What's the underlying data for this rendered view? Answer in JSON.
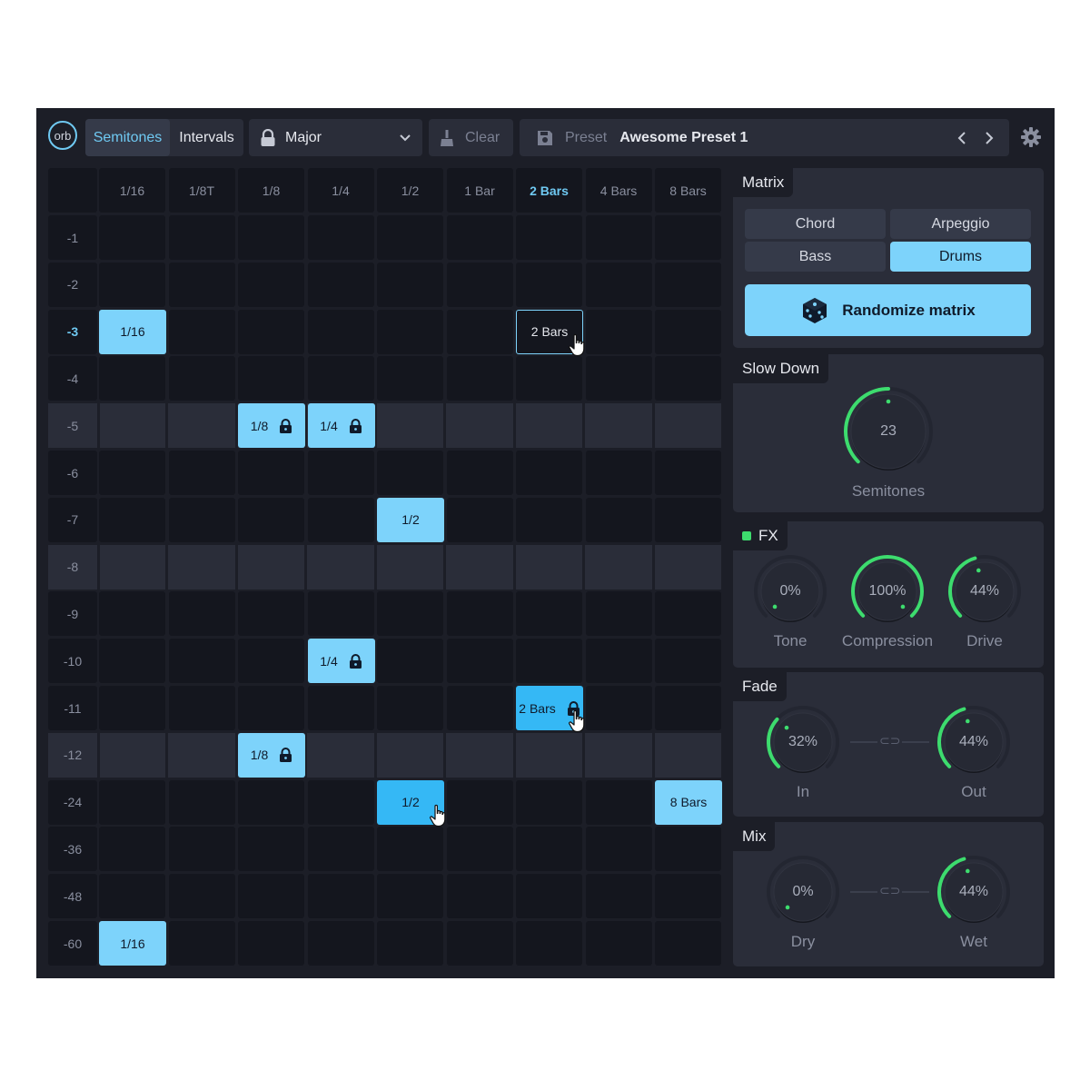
{
  "toolbar": {
    "logo": "orb",
    "tabs": [
      {
        "label": "Semitones",
        "active": true
      },
      {
        "label": "Intervals",
        "active": false
      }
    ],
    "scale": {
      "label": "Major"
    },
    "clear": {
      "label": "Clear"
    },
    "preset": {
      "label": "Preset",
      "name": "Awesome Preset 1"
    }
  },
  "matrix": {
    "columns": [
      "1/16",
      "1/8T",
      "1/8",
      "1/4",
      "1/2",
      "1 Bar",
      "2 Bars",
      "4 Bars",
      "8 Bars"
    ],
    "highlight_column": "2 Bars",
    "rows": [
      "-1",
      "-2",
      "-3",
      "-4",
      "-5",
      "-6",
      "-7",
      "-8",
      "-9",
      "-10",
      "-11",
      "-12",
      "-24",
      "-36",
      "-48",
      "-60"
    ],
    "highlight_row": "-3",
    "locked_rows": [
      "-5",
      "-8",
      "-12"
    ],
    "cells": [
      {
        "row": "-3",
        "col": "1/16",
        "label": "1/16",
        "style": "filled",
        "locked": false
      },
      {
        "row": "-3",
        "col": "2 Bars",
        "label": "2 Bars",
        "style": "outline",
        "locked": false,
        "cursor": true
      },
      {
        "row": "-5",
        "col": "1/8",
        "label": "1/8",
        "style": "filled",
        "locked": true
      },
      {
        "row": "-5",
        "col": "1/4",
        "label": "1/4",
        "style": "filled",
        "locked": true
      },
      {
        "row": "-7",
        "col": "1/2",
        "label": "1/2",
        "style": "filled",
        "locked": false
      },
      {
        "row": "-10",
        "col": "1/4",
        "label": "1/4",
        "style": "filled",
        "locked": true
      },
      {
        "row": "-11",
        "col": "2 Bars",
        "label": "2 Bars",
        "style": "bright",
        "locked": true,
        "cursor": true
      },
      {
        "row": "-12",
        "col": "1/8",
        "label": "1/8",
        "style": "filled",
        "locked": true
      },
      {
        "row": "-24",
        "col": "1/2",
        "label": "1/2",
        "style": "bright",
        "locked": false,
        "cursor": true
      },
      {
        "row": "-24",
        "col": "8 Bars",
        "label": "8 Bars",
        "style": "filled",
        "locked": false
      },
      {
        "row": "-60",
        "col": "1/16",
        "label": "1/16",
        "style": "filled",
        "locked": false
      }
    ]
  },
  "panels": {
    "matrix": {
      "title": "Matrix",
      "modes": [
        {
          "label": "Chord",
          "active": false
        },
        {
          "label": "Arpeggio",
          "active": false
        },
        {
          "label": "Bass",
          "active": false
        },
        {
          "label": "Drums",
          "active": true
        }
      ],
      "randomize_label": "Randomize matrix"
    },
    "slowdown": {
      "title": "Slow Down",
      "knob": {
        "value": "23",
        "label": "Semitones",
        "level": 0.5
      }
    },
    "fx": {
      "title": "FX",
      "enabled": true,
      "knobs": [
        {
          "value": "0%",
          "label": "Tone",
          "level": 0
        },
        {
          "value": "100%",
          "label": "Compression",
          "level": 1
        },
        {
          "value": "44%",
          "label": "Drive",
          "level": 0.44
        }
      ]
    },
    "fade": {
      "title": "Fade",
      "knobs": [
        {
          "value": "32%",
          "label": "In",
          "level": 0.32
        },
        {
          "value": "44%",
          "label": "Out",
          "level": 0.44
        }
      ]
    },
    "mix": {
      "title": "Mix",
      "knobs": [
        {
          "value": "0%",
          "label": "Dry",
          "level": 0
        },
        {
          "value": "44%",
          "label": "Wet",
          "level": 0.44
        }
      ]
    }
  },
  "colors": {
    "accent": "#7dd3fb",
    "accent_bright": "#35b8f5",
    "knob_arc": "#3ddc6e",
    "background": "#1c1e27"
  }
}
